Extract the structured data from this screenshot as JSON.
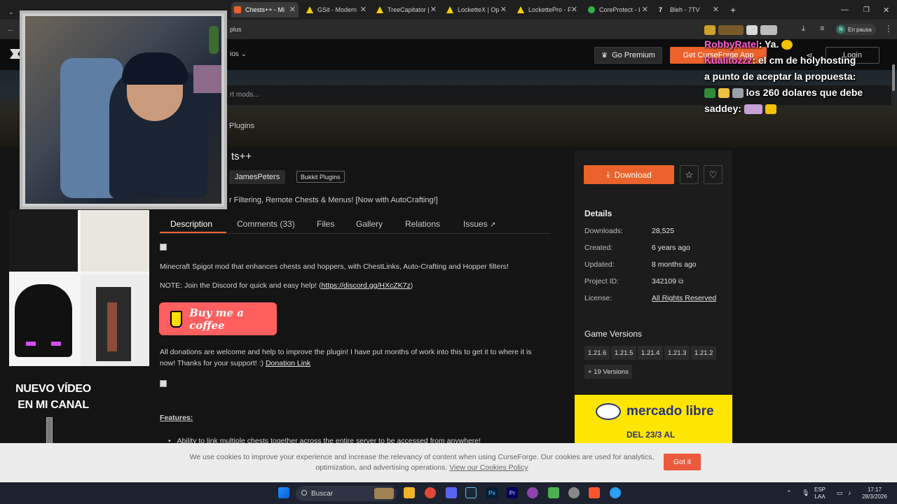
{
  "browser": {
    "tabs": [
      {
        "label": "Chests++ - Mi",
        "favicon_color": "#eb622b",
        "active": true
      },
      {
        "label": "GSit - Modern",
        "favicon_color": "#f2d200"
      },
      {
        "label": "TreeCapitator |",
        "favicon_color": "#f2d200"
      },
      {
        "label": "LocketteX | Op",
        "favicon_color": "#f2d200"
      },
      {
        "label": "LockettePro - F",
        "favicon_color": "#f2d200"
      },
      {
        "label": "CoreProtect - I",
        "favicon_color": "#2db34a"
      },
      {
        "label": "Bleh - 7TV",
        "favicon_color": "#ffffff"
      }
    ],
    "address_fragment": "plus",
    "profile_status": "En pausa",
    "profile_initial": "N"
  },
  "site": {
    "nav_fragment": "ios",
    "premium_label": "Go Premium",
    "getapp_label": "Get CurseForge App",
    "login_label": "Login",
    "search_placeholder": "rt mods...",
    "breadcrumb_last": "Plugins"
  },
  "project": {
    "title": "ts++",
    "author": "JamesPeters",
    "category": "Bukkit Plugins",
    "summary": "r Filtering, Remote Chests & Menus! [Now with AutoCrafting!]",
    "tabs": [
      "Description",
      "Comments (33)",
      "Files",
      "Gallery",
      "Relations",
      "Issues"
    ],
    "active_tab": "Description",
    "desc_line1": "Minecraft Spigot mod that enhances chests and hoppers, with ChestLinks, Auto-Crafting and Hopper filters!",
    "desc_note_prefix": "NOTE: Join the Discord for quick and easy help! (",
    "desc_note_link": "https://discord.gg/HXcZK7z",
    "desc_note_suffix": ")",
    "coffee_label": "Buy me a coffee",
    "donations_line1": "All donations are welcome and help to improve the plugin! I have put months of work into this to get it to where it is",
    "donations_line2_prefix": "now! Thanks for your support! :) ",
    "donations_link": "Donation Link",
    "features_heading": "Features:",
    "features_item1": "Ability to link multiple chests together across the entire server to be accessed from anywhere!"
  },
  "sidebar": {
    "download_label": "Download",
    "details_heading": "Details",
    "details": [
      {
        "label": "Downloads:",
        "value": "28,525"
      },
      {
        "label": "Created:",
        "value": "6 years ago"
      },
      {
        "label": "Updated:",
        "value": "8 months ago"
      },
      {
        "label": "Project ID:",
        "value": "342109"
      },
      {
        "label": "License:",
        "value": "All Rights Reserved"
      }
    ],
    "game_versions_heading": "Game Versions",
    "versions": [
      "1.21.6",
      "1.21.5",
      "1.21.4",
      "1.21.3",
      "1.21.2"
    ],
    "more_versions": "+ 19 Versions"
  },
  "ad": {
    "brand": "mercado libre",
    "date_text": "DEL 23/3 AL"
  },
  "stream": {
    "promo_line1": "NUEVO VÍDEO",
    "promo_line2": "EN MI CANAL",
    "chat": [
      {
        "name": "RobbyRatel",
        "text": ": Ya."
      },
      {
        "name": "Kualitozzz",
        "text": ": el cm de holyhosting"
      },
      {
        "name": "",
        "text": "a punto de aceptar la propuesta:"
      },
      {
        "name": "",
        "text": "los 260 dolares que debe"
      },
      {
        "name": "",
        "text": "saddey:"
      }
    ]
  },
  "cookie": {
    "text_line1": "We use cookies to improve your experience and increase the relevancy of content when using CurseForge. Our cookies are used for analytics,",
    "text_line2": "optimization, and advertising operations. ",
    "policy_link": "View our Cookies Policy",
    "button_label": "Got it"
  },
  "taskbar": {
    "search_label": "Buscar",
    "lang_line1": "ESP",
    "lang_line2": "LAA",
    "time": "17:17",
    "date": "28/3/2026"
  },
  "colors": {
    "accent": "#eb622b",
    "cookie_button": "#eb5a3c",
    "chat_name": "#ff5fd6"
  }
}
